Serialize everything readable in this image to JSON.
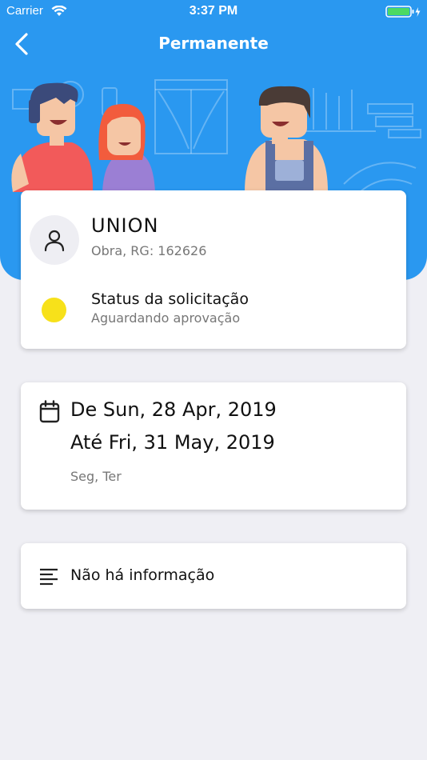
{
  "status_bar": {
    "carrier": "Carrier",
    "time": "3:37 PM"
  },
  "nav": {
    "title": "Permanente",
    "back_icon": "chevron-left-icon"
  },
  "request": {
    "name": "UNION",
    "subtitle": "Obra, RG: 162626",
    "status_label": "Status da solicitação",
    "status_value": "Aguardando aprovação",
    "status_color": "#f7e11a"
  },
  "schedule": {
    "from": "De Sun, 28 Apr, 2019",
    "to": "Até Fri, 31 May, 2019",
    "days": "Seg, Ter"
  },
  "notes": {
    "text": "Não há informação"
  },
  "colors": {
    "header": "#2a98f0",
    "background": "#efeff4"
  }
}
